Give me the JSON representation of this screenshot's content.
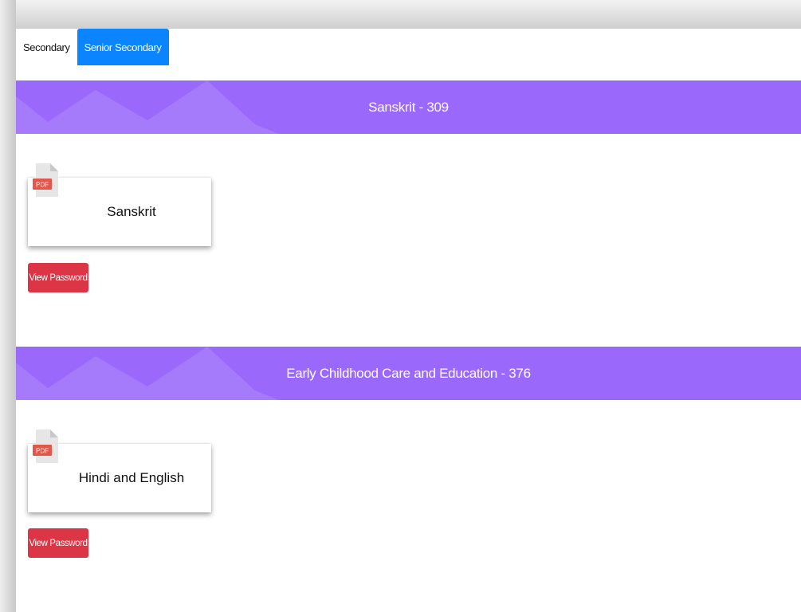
{
  "tabs": [
    {
      "label": "Secondary",
      "active": false
    },
    {
      "label": "Senior Secondary",
      "active": true
    }
  ],
  "sections": [
    {
      "title": "Sanskrit - 309",
      "file": {
        "type_label": "PDF",
        "name": "Sanskrit",
        "icon": "pdf-file-icon"
      },
      "button_label": "View Password"
    },
    {
      "title": "Early Childhood Care and Education - 376",
      "file": {
        "type_label": "PDF",
        "name": "Hindi and English",
        "icon": "pdf-file-icon"
      },
      "button_label": "View Password"
    }
  ],
  "colors": {
    "band": "#9a68fb",
    "active_tab": "#0a84ff",
    "danger_button": "#dc3545",
    "pdf_badge": "#e2574c"
  }
}
